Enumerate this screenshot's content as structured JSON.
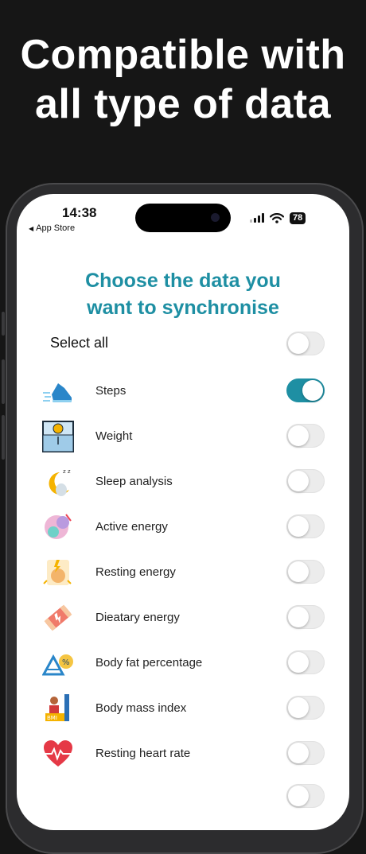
{
  "headline": {
    "line1": "Compatible with",
    "line2": "all type of data"
  },
  "status_bar": {
    "time": "14:38",
    "back_label": "App Store",
    "battery": "78"
  },
  "screen": {
    "title_line1": "Choose the data you",
    "title_line2": "want to synchronise",
    "select_all": {
      "label": "Select all",
      "on": false
    },
    "items": [
      {
        "label": "Steps",
        "icon": "running-shoe-icon",
        "on": true
      },
      {
        "label": "Weight",
        "icon": "scale-icon",
        "on": false
      },
      {
        "label": "Sleep analysis",
        "icon": "moon-sleep-icon",
        "on": false
      },
      {
        "label": "Active energy",
        "icon": "active-energy-icon",
        "on": false
      },
      {
        "label": "Resting energy",
        "icon": "resting-energy-icon",
        "on": false
      },
      {
        "label": "Dieatary energy",
        "icon": "energy-bar-icon",
        "on": false
      },
      {
        "label": "Body fat percentage",
        "icon": "body-fat-icon",
        "on": false
      },
      {
        "label": "Body mass index",
        "icon": "bmi-icon",
        "on": false
      },
      {
        "label": "Resting heart rate",
        "icon": "heart-rate-icon",
        "on": false
      }
    ]
  },
  "colors": {
    "accent": "#1e8fa3",
    "background": "#161616",
    "toggle_off": "#ececec"
  }
}
